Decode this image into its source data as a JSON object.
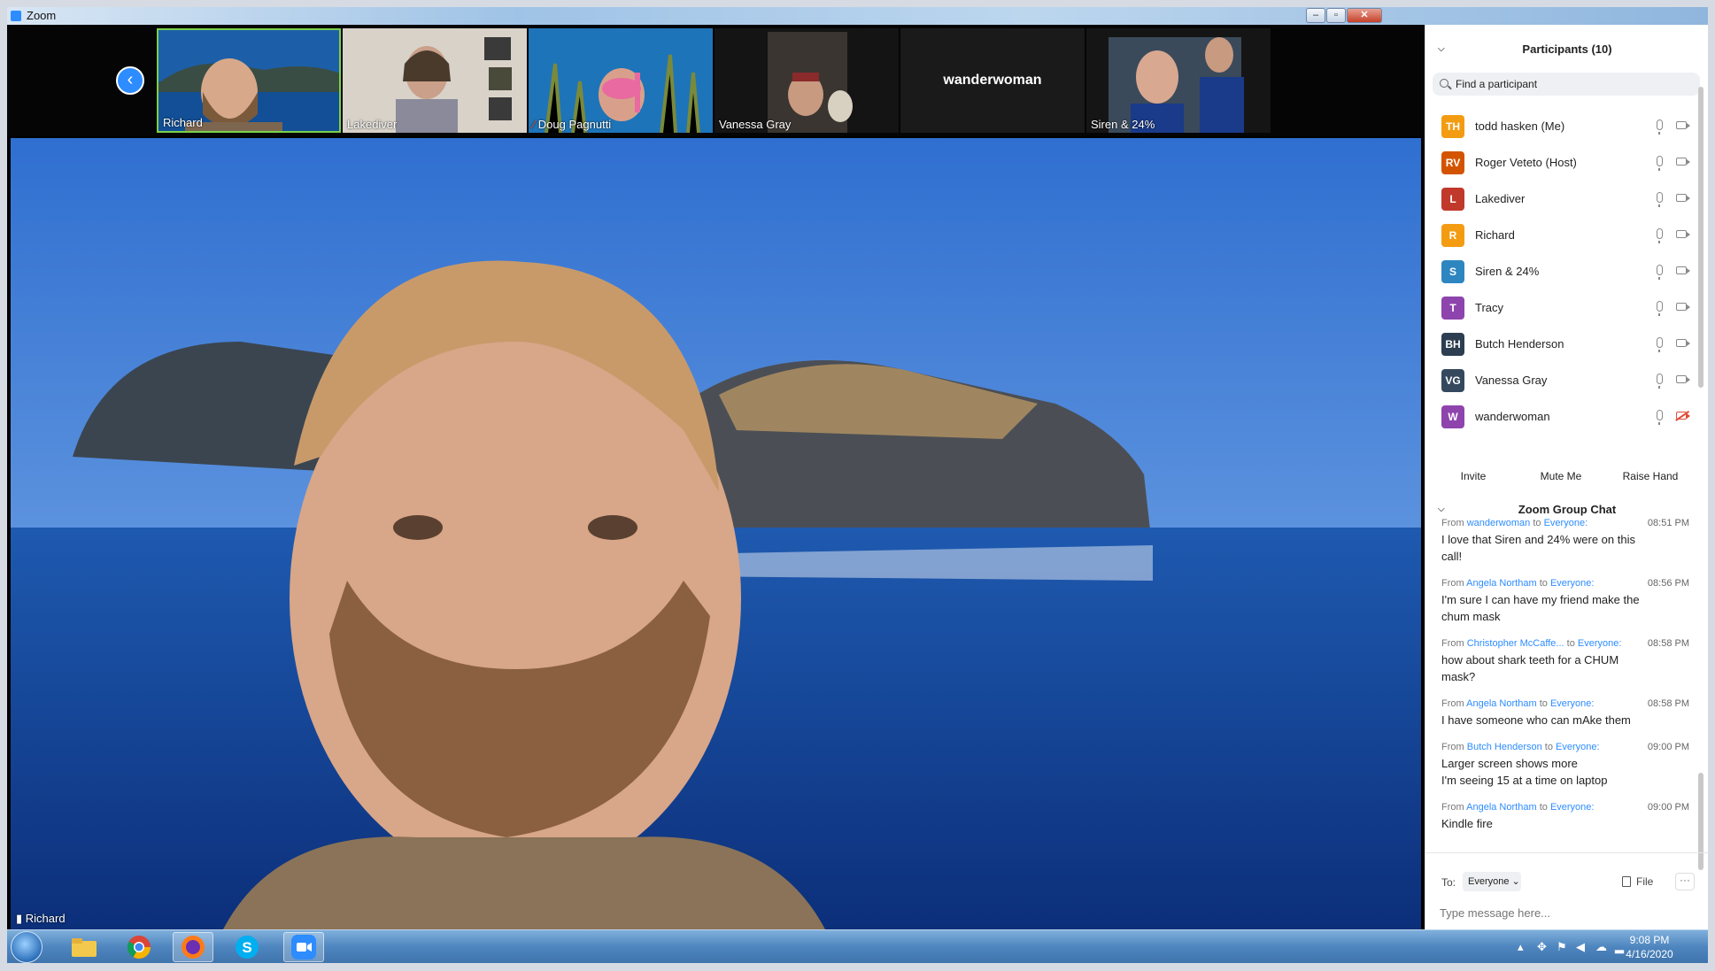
{
  "window": {
    "title": "Zoom"
  },
  "gallery": {
    "thumbnails": [
      {
        "name": "Richard"
      },
      {
        "name": "Lakediver"
      },
      {
        "name": "Doug Pagnutti"
      },
      {
        "name": "Vanessa Gray"
      },
      {
        "name": "wanderwoman"
      },
      {
        "name": "Siren & 24%"
      }
    ]
  },
  "speaker": {
    "name": "Richard"
  },
  "participants": {
    "title": "Participants (10)",
    "search_placeholder": "Find a participant",
    "list": [
      {
        "initials": "TH",
        "name": "todd hasken (Me)",
        "color": "#f39c12",
        "camera": "on"
      },
      {
        "initials": "RV",
        "name": "Roger Veteto (Host)",
        "color": "#d35400",
        "camera": "on"
      },
      {
        "initials": "L",
        "name": "Lakediver",
        "color": "#c0392b",
        "camera": "on"
      },
      {
        "initials": "R",
        "name": "Richard",
        "color": "#f39c12",
        "camera": "on"
      },
      {
        "initials": "S",
        "name": "Siren & 24%",
        "color": "#2e86c1",
        "camera": "on"
      },
      {
        "initials": "T",
        "name": "Tracy",
        "color": "#8e44ad",
        "camera": "on"
      },
      {
        "initials": "BH",
        "name": "Butch Henderson",
        "color": "#2c3e50",
        "camera": "on"
      },
      {
        "initials": "VG",
        "name": "Vanessa Gray",
        "color": "#34495e",
        "camera": "on"
      },
      {
        "initials": "W",
        "name": "wanderwoman",
        "color": "#8e44ad",
        "camera": "off"
      }
    ],
    "buttons": {
      "invite": "Invite",
      "mute": "Mute Me",
      "raise": "Raise Hand"
    }
  },
  "chat": {
    "title": "Zoom Group Chat",
    "messages": [
      {
        "from_word": "From",
        "sender": "wanderwoman",
        "to_word": "to",
        "recipient": "Everyone:",
        "time": "08:51 PM",
        "lines": [
          "I love that Siren and 24% were on this",
          "call!"
        ]
      },
      {
        "from_word": "From",
        "sender": "Angela Northam",
        "to_word": "to",
        "recipient": "Everyone:",
        "time": "08:56 PM",
        "lines": [
          "I'm sure I can have my friend make the",
          "chum mask"
        ]
      },
      {
        "from_word": "From",
        "sender": "Christopher McCaffe...",
        "to_word": "to",
        "recipient": "Everyone:",
        "time": "08:58 PM",
        "lines": [
          "how about shark teeth for a CHUM",
          "mask?"
        ]
      },
      {
        "from_word": "From",
        "sender": "Angela Northam",
        "to_word": "to",
        "recipient": "Everyone:",
        "time": "08:58 PM",
        "lines": [
          "I have someone who can mAke them"
        ]
      },
      {
        "from_word": "From",
        "sender": "Butch Henderson",
        "to_word": "to",
        "recipient": "Everyone:",
        "time": "09:00 PM",
        "lines": [
          "Larger screen shows more",
          "I'm seeing 15 at a time on laptop"
        ]
      },
      {
        "from_word": "From",
        "sender": "Angela Northam",
        "to_word": "to",
        "recipient": "Everyone:",
        "time": "09:00 PM",
        "lines": [
          "Kindle fire"
        ]
      }
    ],
    "to_label": "To:",
    "to_value": "Everyone",
    "file_label": "File",
    "more_label": "···",
    "input_placeholder": "Type message here..."
  },
  "taskbar": {
    "time": "9:08 PM",
    "date": "4/16/2020",
    "apps": [
      "file-explorer",
      "chrome",
      "firefox",
      "skype",
      "zoom"
    ]
  },
  "colors": {
    "accent": "#2d8cff",
    "active_thumb_border": "#7bd14a"
  }
}
